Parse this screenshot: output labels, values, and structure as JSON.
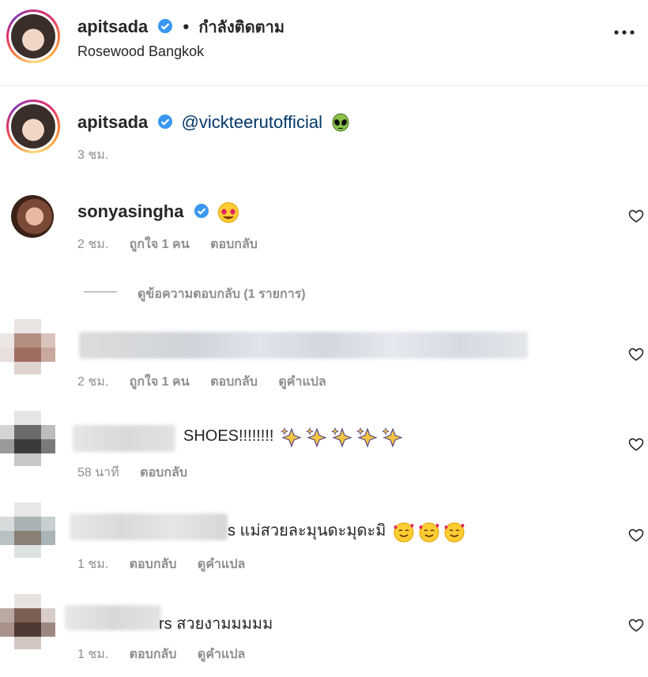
{
  "header": {
    "username": "apitsada",
    "separator": "•",
    "follow_status": "กำลังติดตาม",
    "location": "Rosewood Bangkok",
    "more_icon": "more-horizontal-icon"
  },
  "caption": {
    "username": "apitsada",
    "mention": "@vickteerutofficial",
    "emoji": "alien-emoji",
    "time": "3 ชม."
  },
  "comments": [
    {
      "username": "sonyasingha",
      "verified": true,
      "text_emoji": "heart-eyes-emoji",
      "time": "2 ชม.",
      "likes": "ถูกใจ 1 คน",
      "reply": "ตอบกลับ",
      "view_replies": "ดูข้อความตอบกลับ (1 รายการ)"
    },
    {
      "time": "2 ชม.",
      "likes": "ถูกใจ 1 คน",
      "reply": "ตอบกลับ",
      "translate": "ดูคำแปล"
    },
    {
      "text": "SHOES!!!!!!!!",
      "emoji": "sparkles-emoji",
      "time": "58 นาที",
      "reply": "ตอบกลับ"
    },
    {
      "text": "s แม่สวยละมุนดะมุดะมิ",
      "emoji": "smiling-hearts-emoji",
      "time": "1 ชม.",
      "reply": "ตอบกลับ",
      "translate": "ดูคำแปล"
    },
    {
      "text": "rs สวยงามมมมม",
      "time": "1 ชม.",
      "reply": "ตอบกลับ",
      "translate": "ดูคำแปล"
    }
  ],
  "colors": {
    "verified_blue": "#3897f0",
    "mention_blue": "#00376b",
    "muted_gray": "#8e8e8e"
  }
}
